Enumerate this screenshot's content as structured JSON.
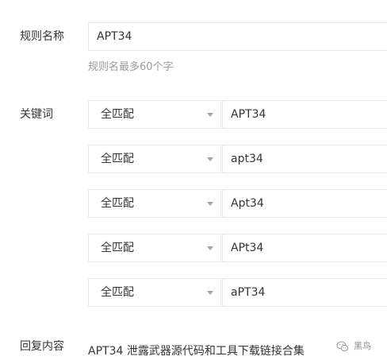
{
  "rule_name": {
    "label": "规则名称",
    "value": "APT34",
    "hint": "规则名最多60个字"
  },
  "keywords": {
    "label": "关键词",
    "rows": [
      {
        "match": "全匹配",
        "value": "APT34"
      },
      {
        "match": "全匹配",
        "value": "apt34"
      },
      {
        "match": "全匹配",
        "value": "Apt34"
      },
      {
        "match": "全匹配",
        "value": "APt34"
      },
      {
        "match": "全匹配",
        "value": "aPT34"
      }
    ]
  },
  "reply": {
    "label": "回复内容",
    "value": "APT34 泄露武器源代码和工具下载链接合集"
  },
  "watermark": {
    "text": "黑鸟",
    "icon": "wechat-icon"
  }
}
